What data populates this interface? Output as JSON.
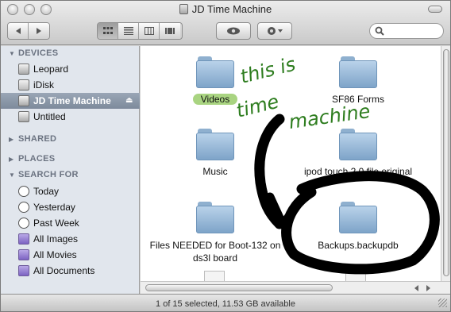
{
  "window": {
    "title": "JD Time Machine"
  },
  "toolbar": {
    "back_icon": "back-arrow-icon",
    "forward_icon": "forward-arrow-icon",
    "views": [
      "icon-view",
      "list-view",
      "column-view",
      "coverflow-view"
    ],
    "quicklook_icon": "eye-icon",
    "action_icon": "gear-icon",
    "search": {
      "value": "",
      "placeholder": ""
    }
  },
  "sidebar": {
    "devices": {
      "header": "DEVICES",
      "items": [
        {
          "label": "Leopard",
          "icon": "hard-drive-icon"
        },
        {
          "label": "iDisk",
          "icon": "idisk-icon"
        },
        {
          "label": "JD Time Machine",
          "icon": "hard-drive-icon",
          "selected": true
        },
        {
          "label": "Untitled",
          "icon": "hard-drive-icon"
        }
      ]
    },
    "shared": {
      "header": "SHARED"
    },
    "places": {
      "header": "PLACES"
    },
    "search_for": {
      "header": "SEARCH FOR",
      "items": [
        {
          "label": "Today",
          "icon": "clock-icon"
        },
        {
          "label": "Yesterday",
          "icon": "clock-icon"
        },
        {
          "label": "Past Week",
          "icon": "clock-icon"
        },
        {
          "label": "All Images",
          "icon": "smart-folder-icon"
        },
        {
          "label": "All Movies",
          "icon": "smart-folder-icon"
        },
        {
          "label": "All Documents",
          "icon": "smart-folder-icon"
        }
      ]
    }
  },
  "content": {
    "items": [
      {
        "label": "Videos",
        "label_color": "#a9d481"
      },
      {
        "label": "SF86 Forms"
      },
      {
        "label": "Music"
      },
      {
        "label": "ipod touch 2.0 file original"
      },
      {
        "label": "Files NEEDED for Boot-132 on ds3l board"
      },
      {
        "label": "Backups.backupdb"
      }
    ]
  },
  "annotation": {
    "handwritten_note": [
      "this is",
      "time",
      "machine"
    ],
    "note_color": "#2e7d1f",
    "marker_color": "#000000"
  },
  "status_bar": {
    "text": "1 of 15 selected, 11.53 GB available"
  }
}
